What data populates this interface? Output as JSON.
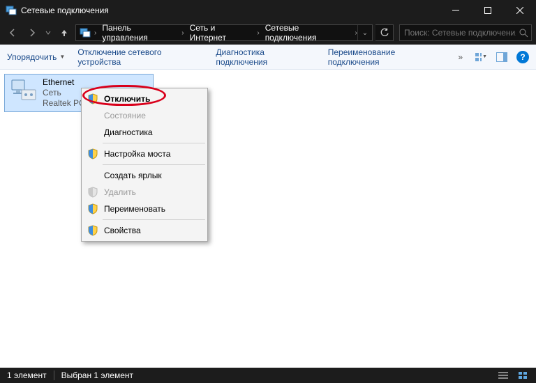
{
  "title": "Сетевые подключения",
  "breadcrumb": {
    "segs": [
      "Панель управления",
      "Сеть и Интернет",
      "Сетевые подключения"
    ]
  },
  "search": {
    "placeholder": "Поиск: Сетевые подключения"
  },
  "toolbar": {
    "organize": "Упорядочить",
    "disable": "Отключение сетевого устройства",
    "diagnose": "Диагностика подключения",
    "rename": "Переименование подключения"
  },
  "adapter": {
    "name": "Ethernet",
    "status": "Сеть",
    "device": "Realtek PCIe"
  },
  "ctx": {
    "disable": "Отключить",
    "status": "Состояние",
    "diagnose": "Диагностика",
    "bridge": "Настройка моста",
    "shortcut": "Создать ярлык",
    "delete": "Удалить",
    "rename": "Переименовать",
    "properties": "Свойства"
  },
  "statusbar": {
    "count": "1 элемент",
    "selected": "Выбран 1 элемент"
  }
}
